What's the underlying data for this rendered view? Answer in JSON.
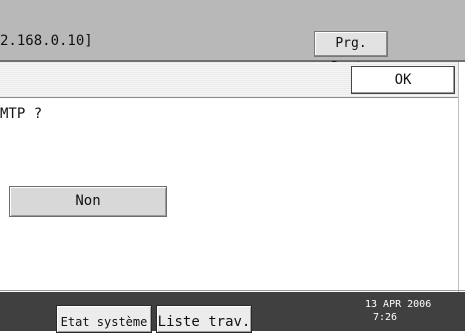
{
  "header": {
    "address": "2.168.0.10]",
    "prg_dest_label": "Prg. Dest."
  },
  "toolbar": {
    "ok_label": "OK"
  },
  "dialog": {
    "question": "MTP ?",
    "non_label": "Non"
  },
  "footer": {
    "etat_systeme_label": "Etat système",
    "liste_trav_label": "Liste trav.",
    "date": "13 APR  2006",
    "time": "7:26"
  }
}
